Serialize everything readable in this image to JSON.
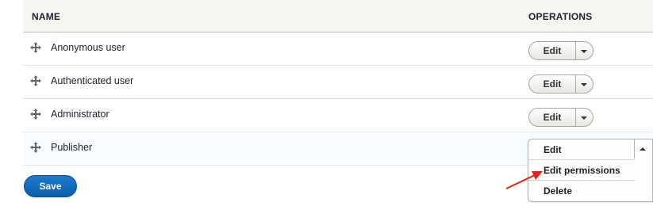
{
  "table": {
    "headers": {
      "name": "NAME",
      "operations": "OPERATIONS"
    },
    "rows": [
      {
        "label": "Anonymous user",
        "action": "Edit"
      },
      {
        "label": "Authenticated user",
        "action": "Edit"
      },
      {
        "label": "Administrator",
        "action": "Edit"
      },
      {
        "label": "Publisher",
        "action": "Edit"
      }
    ]
  },
  "dropdown_menu": {
    "items": [
      "Edit",
      "Edit permissions",
      "Delete"
    ]
  },
  "form": {
    "save_label": "Save"
  },
  "colors": {
    "primary_button": "#0a5fa8",
    "annotation_arrow": "#e8201a",
    "header_bg": "#f5f5f2"
  }
}
